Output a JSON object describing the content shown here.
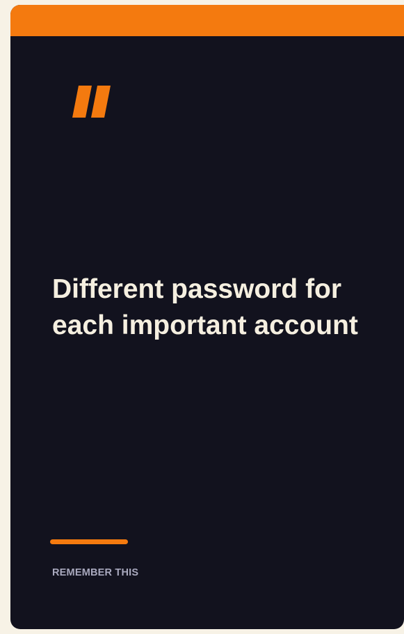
{
  "card": {
    "quote_icon": "quote-mark-icon",
    "headline": "Different password for each important account",
    "caption": "REMEMBER THIS"
  },
  "colors": {
    "background": "#f7f2e6",
    "card": "#12121e",
    "accent": "#f47a0f",
    "headline_text": "#f5efe0",
    "caption_text": "#a9a9be"
  }
}
